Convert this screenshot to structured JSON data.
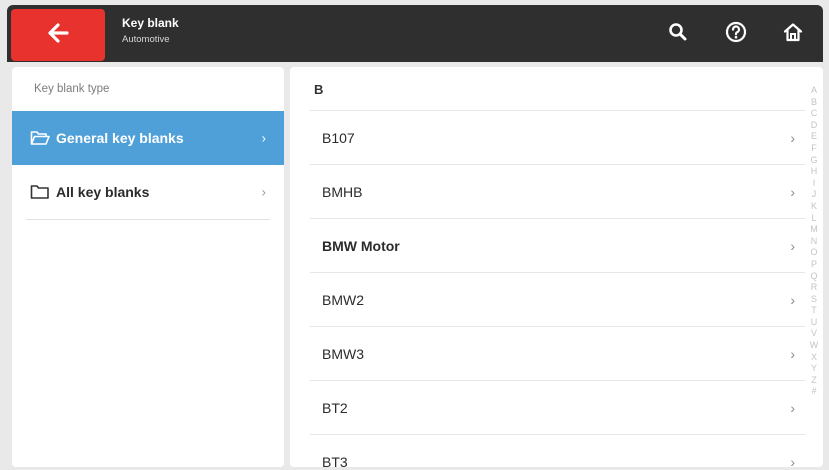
{
  "header": {
    "title": "Key blank",
    "subtitle": "Automotive",
    "back_icon": "back-arrow-icon",
    "actions": [
      "search-icon",
      "help-icon",
      "home-icon"
    ],
    "back_color": "#e8322e",
    "bg_color": "#2f2f2f"
  },
  "sidebar": {
    "heading": "Key blank type",
    "items": [
      {
        "label": "General key blanks",
        "icon": "folder-open-icon",
        "active": true
      },
      {
        "label": "All key blanks",
        "icon": "folder-icon",
        "active": false
      }
    ],
    "accent": "#4f9fd9"
  },
  "list": {
    "section": "B",
    "items": [
      "B107",
      "BMHB",
      "BMW Motor",
      "BMW2",
      "BMW3",
      "BT2",
      "BT3"
    ],
    "index_letters": [
      "A",
      "B",
      "C",
      "D",
      "E",
      "F",
      "G",
      "H",
      "I",
      "J",
      "K",
      "L",
      "M",
      "N",
      "O",
      "P",
      "Q",
      "R",
      "S",
      "T",
      "U",
      "V",
      "W",
      "X",
      "Y",
      "Z",
      "#"
    ]
  }
}
